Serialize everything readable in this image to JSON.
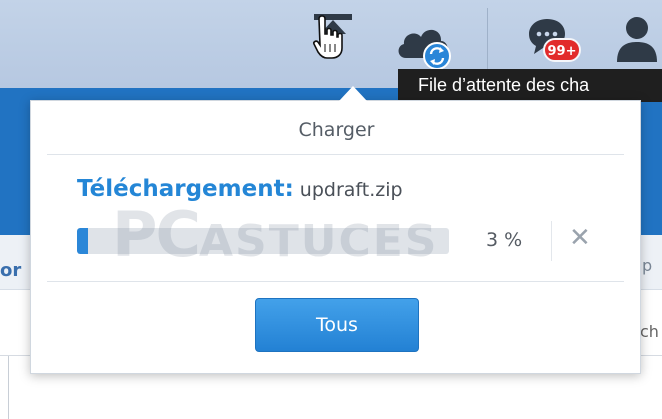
{
  "tooltip": {
    "text": "File d’attente des cha"
  },
  "notifications": {
    "badge": "99+"
  },
  "background": {
    "left_fragment": "or",
    "right_fragment_top": "p",
    "right_fragment_bottom": "ch"
  },
  "watermark": {
    "big": "PC",
    "small": "ASTUCES"
  },
  "upload_panel": {
    "title": "Charger",
    "download_label": "Téléchargement:",
    "file_name": "updraft.zip",
    "progress_percent": 3,
    "progress_text": "3 %",
    "cancel_icon": "close-icon",
    "all_button_label": "Tous"
  },
  "colors": {
    "topbar": "#bccee6",
    "accent_blue": "#2486d6",
    "nav_blue": "#2173c2",
    "badge_red": "#e22b2b",
    "tooltip_bg": "#1f1f1f"
  },
  "icons": [
    "upload-icon",
    "cursor-hand-icon",
    "cloud-sync-icon",
    "chat-notification-icon",
    "user-icon"
  ]
}
